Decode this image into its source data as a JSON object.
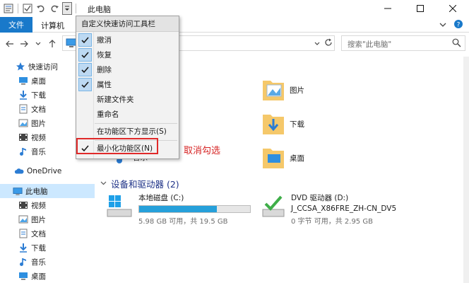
{
  "window": {
    "title": "此电脑",
    "quick_access_icons": [
      "properties-icon",
      "checkmark-icon",
      "undo-icon",
      "redo-icon"
    ]
  },
  "ribbon": {
    "tabs": [
      "文件",
      "计算机"
    ]
  },
  "search": {
    "placeholder": "搜索\"此电脑\""
  },
  "sidebar": {
    "quick_access": "快速访问",
    "quick_items": [
      "桌面",
      "下载",
      "文档",
      "图片",
      "视频",
      "音乐"
    ],
    "onedrive": "OneDrive",
    "this_pc": "此电脑",
    "pc_items": [
      "视频",
      "图片",
      "文档",
      "下载",
      "音乐",
      "桌面"
    ]
  },
  "content": {
    "folders": [
      "图片",
      "下载",
      "桌面"
    ],
    "partial_folder": "音乐",
    "devices_title": "设备和驱动器 (2)",
    "drives": [
      {
        "name": "本地磁盘 (C:)",
        "info": "5.98 GB 可用，共 19.5 GB",
        "used_fraction": 0.7
      },
      {
        "name": "DVD 驱动器 (D:)",
        "name2": "J_CCSA_X86FRE_ZH-CN_DV5",
        "info": "0 字节 可用，共 2.95 GB"
      }
    ]
  },
  "menu": {
    "header": "自定义快速访问工具栏",
    "items": [
      {
        "label": "撤消",
        "checked": true
      },
      {
        "label": "恢复",
        "checked": true
      },
      {
        "label": "删除",
        "checked": true
      },
      {
        "label": "属性",
        "checked": true
      },
      {
        "label": "新建文件夹",
        "checked": false
      },
      {
        "label": "重命名",
        "checked": false
      },
      {
        "label": "在功能区下方显示(S)",
        "checked": false
      },
      {
        "label": "最小化功能区(N)",
        "checked": true
      }
    ]
  },
  "annotation": "取消勾选",
  "colors": {
    "accent": "#1979ca",
    "selection": "#cce8ff",
    "annotation_red": "#e02a2a",
    "drive_bar": "#26a0da",
    "section_title": "#1e3287"
  }
}
